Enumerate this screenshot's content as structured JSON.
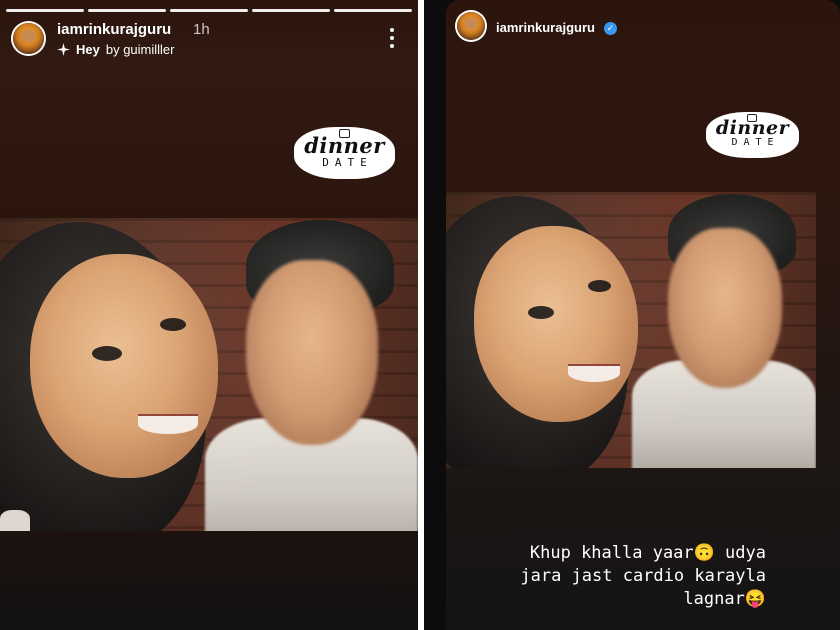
{
  "left_story": {
    "progress_segments": [
      {
        "state": "done"
      },
      {
        "state": "done"
      },
      {
        "state": "current"
      },
      {
        "state": "upcoming"
      },
      {
        "state": "upcoming"
      }
    ],
    "username": "iamrinkurajguru",
    "time_ago": "1h",
    "music": {
      "icon": "sparkle-icon",
      "song": "Hey",
      "by_text": "by guimilller"
    },
    "more_icon": "more-vertical-icon",
    "sticker": {
      "top_text": "dinner",
      "bottom_text": "DATE"
    }
  },
  "right_story": {
    "username": "iamrinkurajguru",
    "verified": true,
    "sticker": {
      "top_text": "dinner",
      "bottom_text": "DATE"
    },
    "caption": "Khup khalla yaar🙃 udya\njara jast cardio karayla\nlagnar😝"
  },
  "colors": {
    "story_background_top": "#2b150d",
    "story_background_bottom": "#141414",
    "verified_badge": "#3897f0",
    "text": "#ffffff"
  }
}
